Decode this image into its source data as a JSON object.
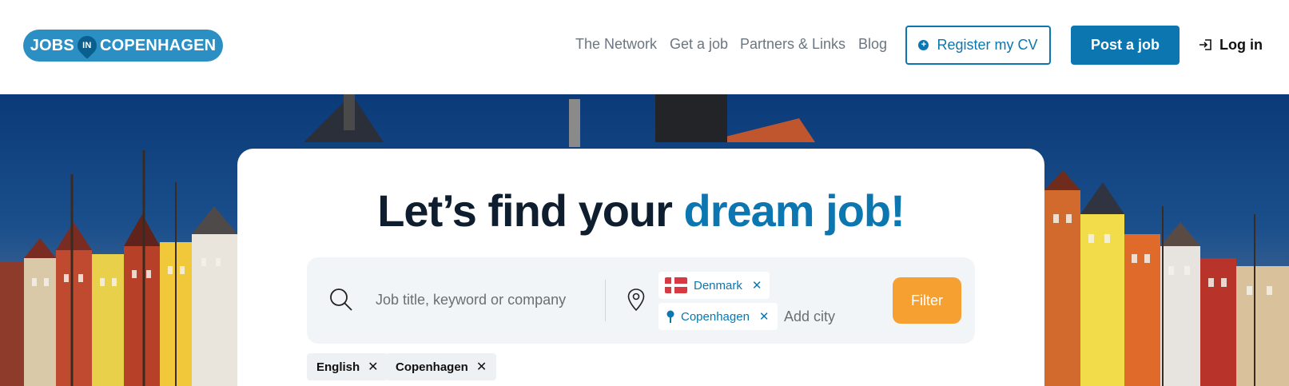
{
  "brand": {
    "logo_left": "JOBS",
    "logo_pin": "IN",
    "logo_right": "COPENHAGEN"
  },
  "nav": {
    "links": [
      "The Network",
      "Get a job",
      "Partners & Links",
      "Blog"
    ],
    "register_cv": "Register my CV",
    "post_job": "Post a job",
    "login": "Log in"
  },
  "hero": {
    "headline_main": "Let’s find your ",
    "headline_accent": "dream job!"
  },
  "search": {
    "keyword_placeholder": "Job title, keyword or company",
    "country_chip": "Denmark",
    "city_chip": "Copenhagen",
    "add_city_placeholder": "Add city",
    "filter_label": "Filter"
  },
  "active_tags": [
    "English",
    "Copenhagen"
  ],
  "colors": {
    "brand_blue": "#0b76b0",
    "logo_blue": "#2b8fc4",
    "filter_orange": "#f7a032",
    "headline_dark": "#0e1e2e"
  }
}
